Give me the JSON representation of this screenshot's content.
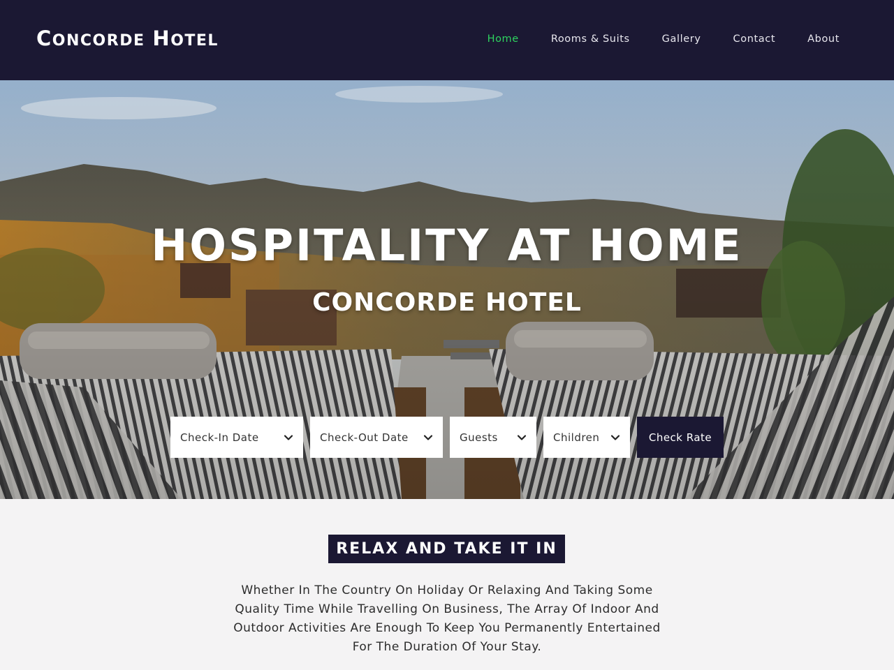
{
  "header": {
    "brand_first_initial": "C",
    "brand_first_rest": "ONCORDE",
    "brand_second_initial": "H",
    "brand_second_rest": "OTEL",
    "nav": [
      {
        "label": "Home",
        "active": true
      },
      {
        "label": "Rooms & Suits",
        "active": false
      },
      {
        "label": "Gallery",
        "active": false
      },
      {
        "label": "Contact",
        "active": false
      },
      {
        "label": "About",
        "active": false
      }
    ]
  },
  "hero": {
    "title": "HOSPITALITY AT HOME",
    "subtitle": "CONCORDE HOTEL"
  },
  "booking": {
    "check_in": "Check-In Date",
    "check_out": "Check-Out Date",
    "guests": "Guests",
    "children": "Children",
    "submit": "Check Rate"
  },
  "intro": {
    "heading": "RELAX AND TAKE IT IN",
    "body": "Whether In The Country On Holiday Or Relaxing And Taking Some Quality Time While Travelling On Business, The Array Of Indoor And Outdoor Activities Are Enough To Keep You Permanently Entertained For The Duration Of Your Stay."
  },
  "colors": {
    "navy": "#1b1833",
    "nav_active": "#2ed35f",
    "page_bg": "#f4f3f4",
    "white": "#ffffff"
  },
  "icons": {
    "select_arrow": "chevron-down-icon"
  }
}
